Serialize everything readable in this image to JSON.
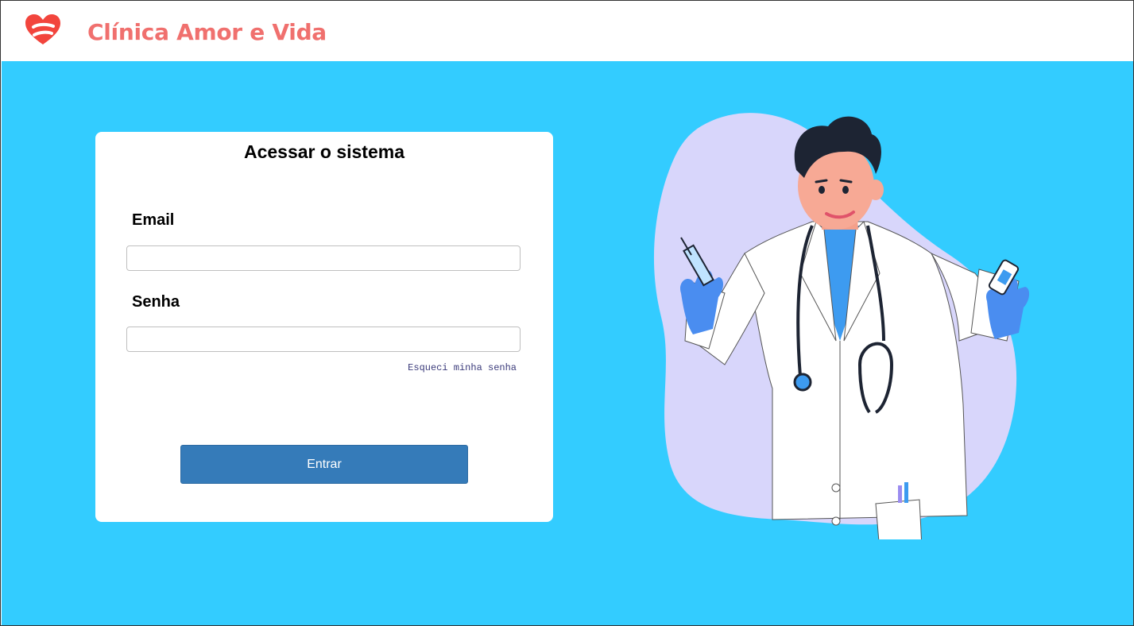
{
  "header": {
    "brand_name": "Clínica Amor e Vida",
    "logo_icon": "heart-logo-icon",
    "brand_color": "#f0706e"
  },
  "login": {
    "title": "Acessar o sistema",
    "email_label": "Email",
    "email_value": "",
    "password_label": "Senha",
    "password_value": "",
    "forgot_password": "Esqueci minha senha",
    "submit_label": "Entrar"
  },
  "illustration": {
    "icon": "doctor-illustration-icon"
  },
  "colors": {
    "background": "#33ccff",
    "button": "#357bb9",
    "blob": "#d8d6fb"
  }
}
